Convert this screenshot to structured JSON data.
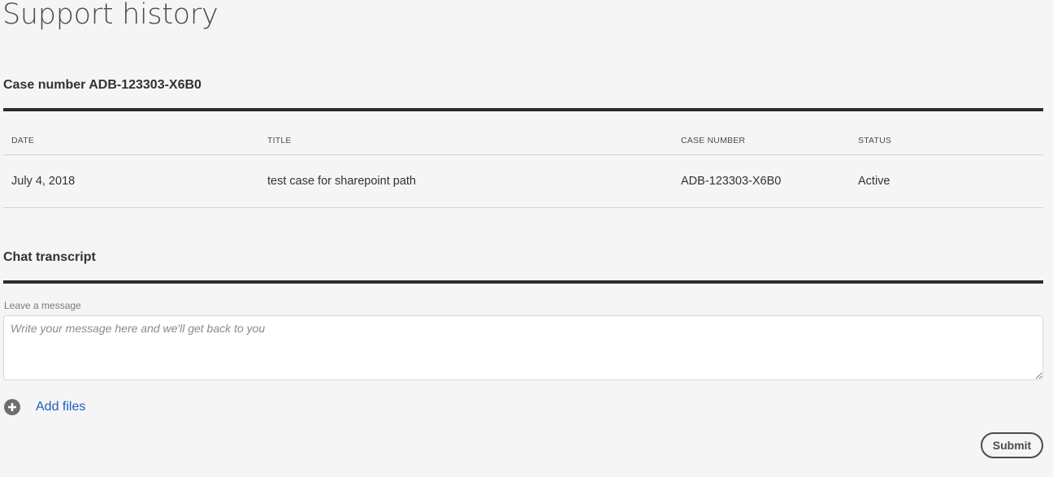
{
  "page": {
    "title": "Support history"
  },
  "case_section": {
    "heading": "Case number ADB-123303-X6B0"
  },
  "table": {
    "columns": [
      "DATE",
      "TITLE",
      "CASE NUMBER",
      "STATUS"
    ],
    "rows": [
      {
        "date": "July 4, 2018",
        "title": "test case for sharepoint path",
        "case_number": "ADB-123303-X6B0",
        "status": "Active"
      }
    ]
  },
  "chat_section": {
    "heading": "Chat transcript",
    "message_label": "Leave a message",
    "message_placeholder": "Write your message here and we'll get back to you",
    "message_value": "",
    "add_files_label": "Add files",
    "add_files_icon": "plus-circle-icon",
    "submit_label": "Submit"
  },
  "colors": {
    "background": "#f5f5f5",
    "rule": "#2c2c2c",
    "link": "#1a5ebd",
    "icon": "#6e6e6e"
  }
}
